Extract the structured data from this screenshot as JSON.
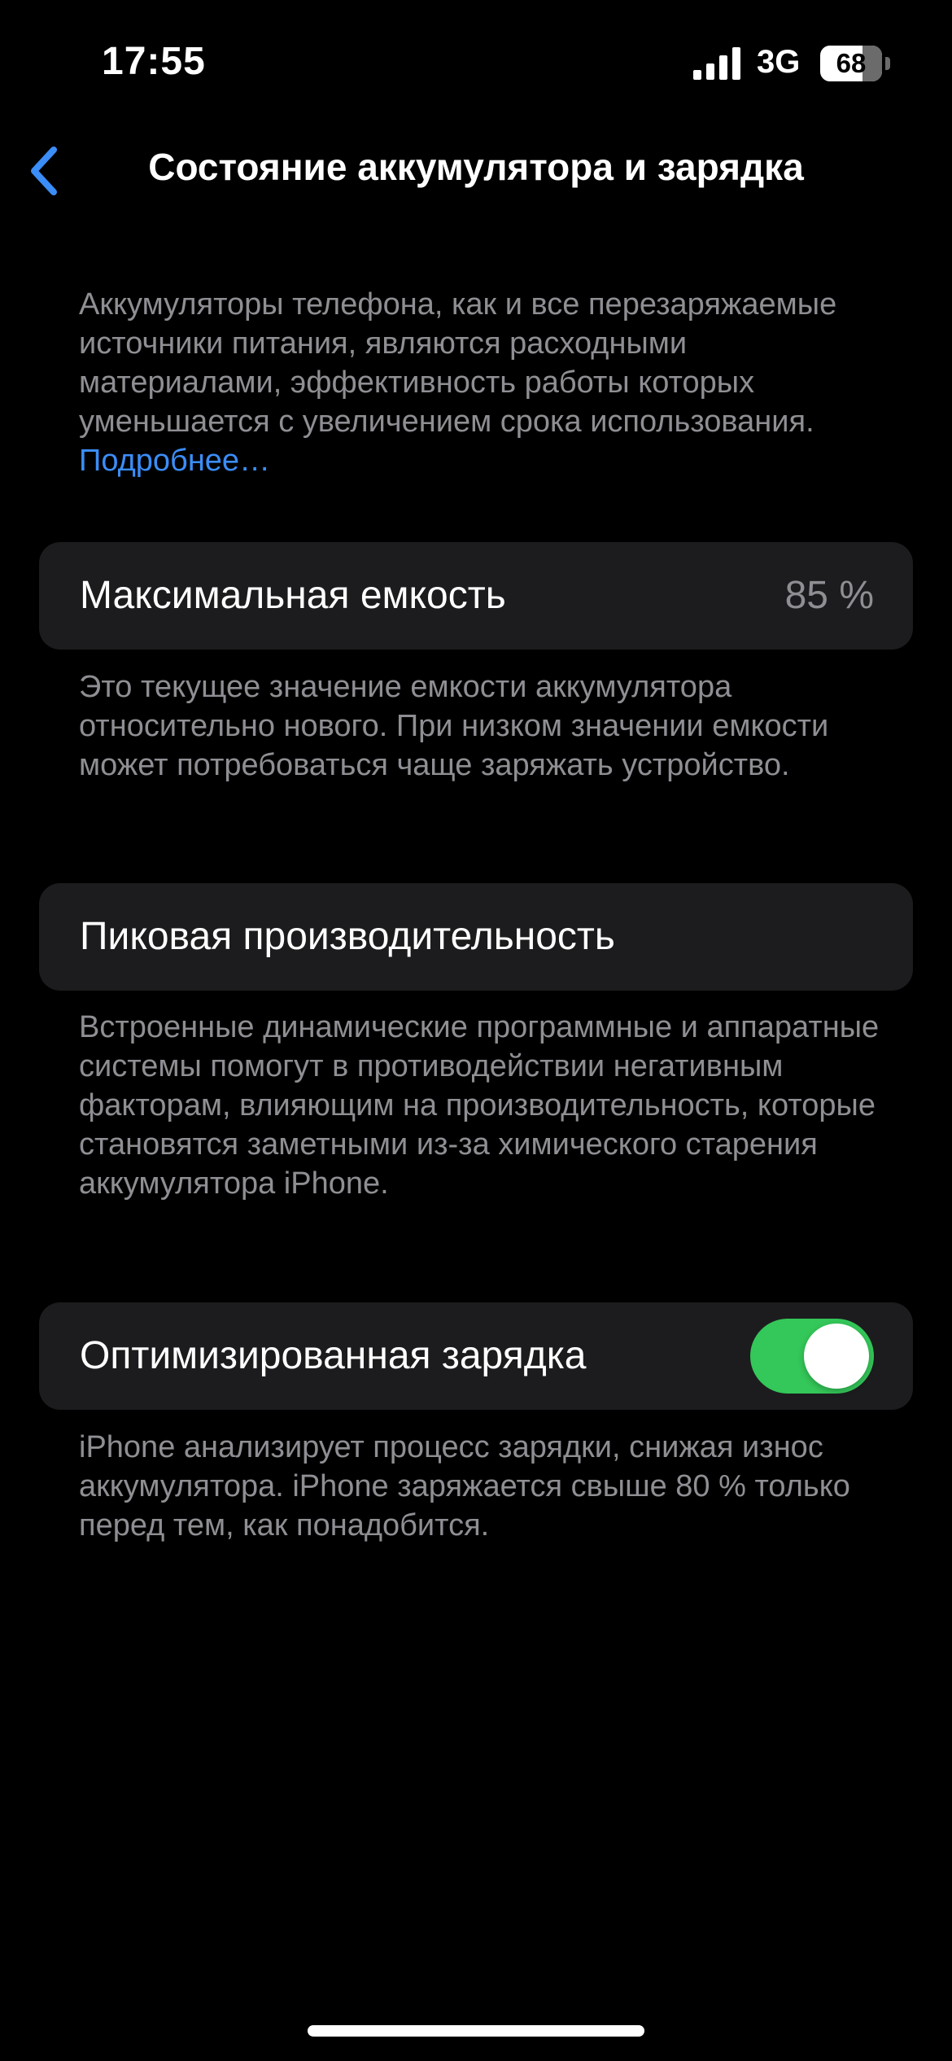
{
  "status_bar": {
    "time": "17:55",
    "network": "3G",
    "battery_percent": "68",
    "battery_level": 0.68,
    "signal_icon": "cellular-signal-icon"
  },
  "nav": {
    "back_icon": "chevron-left-icon",
    "title": "Состояние аккумулятора и зарядка"
  },
  "intro": {
    "text": "Аккумуляторы телефона, как и все перезаряжаемые источники питания, являются расходными материалами, эффективность работы которых уменьшается с увеличением срока использования.",
    "link": "Подробнее…"
  },
  "max_capacity": {
    "label": "Максимальная емкость",
    "value": "85 %",
    "description": "Это текущее значение емкости аккумулятора относительно нового. При низком значении емкости может потребоваться чаще заряжать устройство."
  },
  "peak_performance": {
    "label": "Пиковая производительность",
    "description": "Встроенные динамические программные и аппаратные системы помогут в противодействии негативным факторам, влияющим на производительность, которые становятся заметными из-за химического старения аккумулятора iPhone."
  },
  "optimized_charging": {
    "label": "Оптимизированная зарядка",
    "enabled": true,
    "description": "iPhone анализирует процесс зарядки, снижая износ аккумулятора. iPhone заряжается свыше 80 % только перед тем, как понадобится."
  },
  "colors": {
    "background": "#000000",
    "cell": "#1c1c1e",
    "secondary_text": "#8e8e93",
    "link": "#3b8df7",
    "toggle_on": "#34c759"
  }
}
